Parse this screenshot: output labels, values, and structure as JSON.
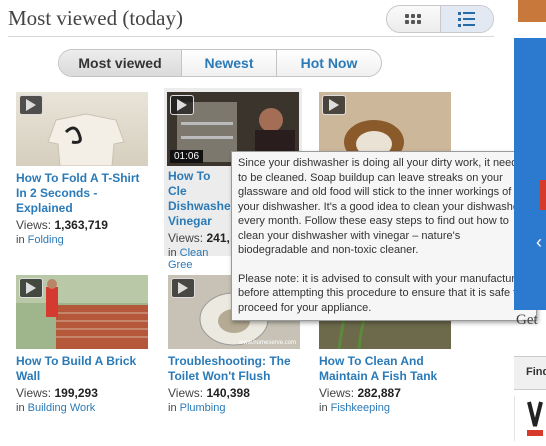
{
  "header": {
    "title": "Most viewed (today)"
  },
  "view_toggle": [
    {
      "icon": "grid-view-icon",
      "selected": false
    },
    {
      "icon": "list-view-icon",
      "selected": true
    }
  ],
  "tabs": [
    {
      "label": "Most viewed",
      "active": true
    },
    {
      "label": "Newest",
      "active": false
    },
    {
      "label": "Hot Now",
      "active": false
    }
  ],
  "videos": [
    {
      "title": "How To Fold A T-Shirt In 2 Seconds - Explained",
      "views_label": "Views:",
      "views": "1,363,719",
      "in": "in",
      "category": "Folding"
    },
    {
      "title": "How To Clean Your Dishwasher With Vinegar",
      "title_visible": [
        "How To Cle",
        "Dishwashe",
        "Vinegar"
      ],
      "views_label": "Views:",
      "views": "241,",
      "in": "in",
      "category": "Clean Gree",
      "duration": "01:06"
    },
    {
      "title": ""
    },
    {
      "title": "How To Build A Brick Wall",
      "views_label": "Views:",
      "views": "199,293",
      "in": "in",
      "category": "Building Work"
    },
    {
      "title": "Troubleshooting: The Toilet Won't Flush",
      "views_label": "Views:",
      "views": "140,398",
      "in": "in",
      "category": "Plumbing",
      "watermark": "www.homeserve.com"
    },
    {
      "title": "How To Clean And Maintain A Fish Tank",
      "views_label": "Views:",
      "views": "282,887",
      "in": "in",
      "category": "Fishkeeping"
    }
  ],
  "tooltip": {
    "paragraph1": "Since your dishwasher is doing all your dirty work, it needs to be cleaned.  Soap buildup can leave streaks on your glassware and old food will stick to the inner workings of your dishwasher.  It's a good idea to clean your dishwasher every month.  Follow these easy steps to find out how to clean your dishwasher with vinegar – nature's biodegradable and non-toxic cleaner.",
    "paragraph2": "Please note: it is advised to consult with your manufacturer before attempting this procedure to ensure that it is safe to proceed for your appliance."
  },
  "sidebar": {
    "get_label": "Get",
    "find_label": "Find"
  }
}
